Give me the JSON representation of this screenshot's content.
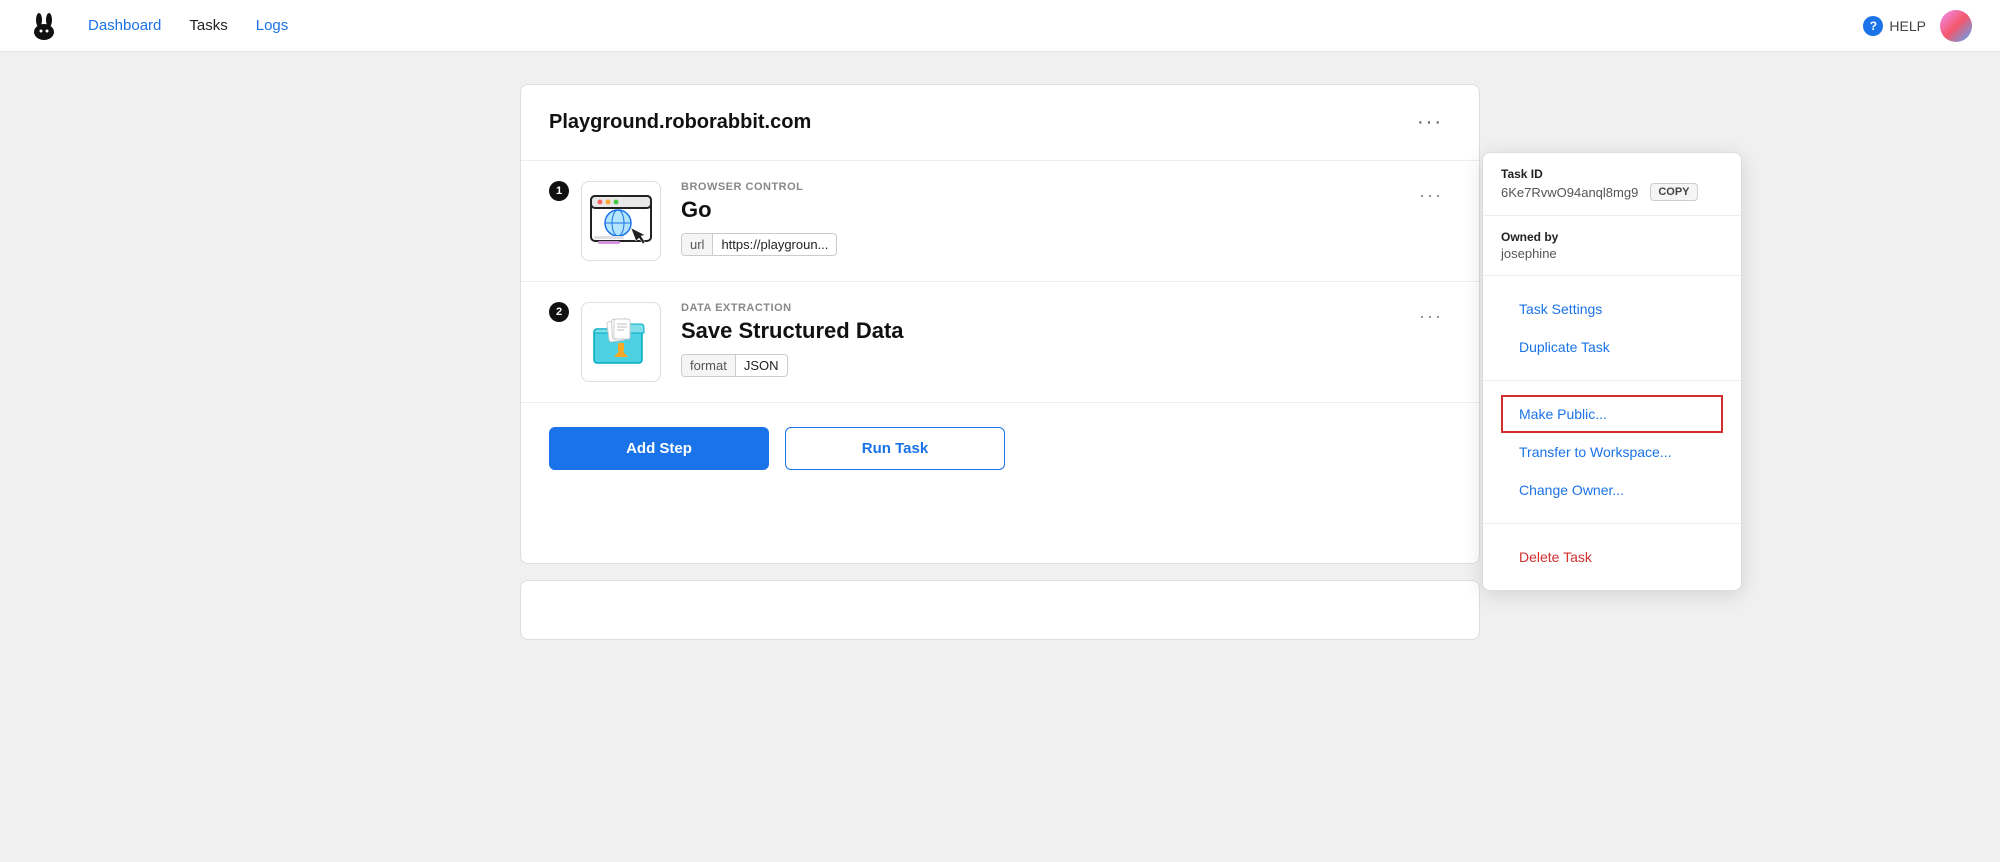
{
  "nav": {
    "logo_alt": "RoboRabbit logo",
    "links": [
      {
        "label": "Dashboard",
        "active": false
      },
      {
        "label": "Tasks",
        "active": true
      },
      {
        "label": "Logs",
        "active": false
      }
    ],
    "help_label": "HELP",
    "avatar_alt": "User avatar"
  },
  "task_card": {
    "title": "Playground.roborabbit.com",
    "more_button_label": "···",
    "steps": [
      {
        "number": "1",
        "category": "BROWSER CONTROL",
        "name": "Go",
        "params": [
          {
            "key": "url",
            "value": "https://playgroun..."
          }
        ]
      },
      {
        "number": "2",
        "category": "DATA EXTRACTION",
        "name": "Save Structured Data",
        "params": [
          {
            "key": "format",
            "value": "JSON"
          }
        ]
      }
    ],
    "add_step_label": "Add Step",
    "run_task_label": "Run Task"
  },
  "dropdown": {
    "task_id_label": "Task ID",
    "task_id_value": "6Ke7RvwO94anql8mg9",
    "copy_label": "COPY",
    "owned_by_label": "Owned by",
    "owned_by_value": "josephine",
    "actions": [
      {
        "label": "Task Settings",
        "type": "normal"
      },
      {
        "label": "Duplicate Task",
        "type": "normal"
      },
      {
        "label": "Make Public...",
        "type": "highlighted"
      },
      {
        "label": "Transfer to Workspace...",
        "type": "normal"
      },
      {
        "label": "Change Owner...",
        "type": "normal"
      },
      {
        "label": "Delete Task",
        "type": "danger"
      }
    ]
  }
}
